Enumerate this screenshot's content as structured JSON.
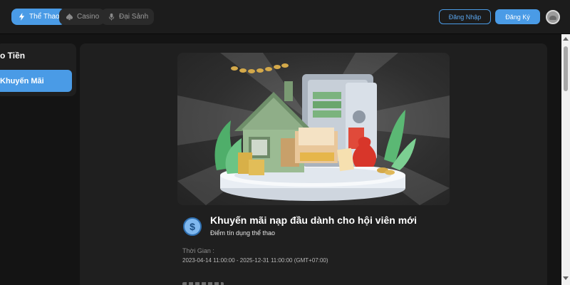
{
  "header": {
    "tabs": [
      {
        "label": "Thể Thao",
        "icon": "lightning-icon",
        "active": true
      },
      {
        "label": "Casino",
        "icon": "spade-icon",
        "active": false
      },
      {
        "label": "Đại Sảnh",
        "icon": "microphone-icon",
        "active": false
      }
    ],
    "login_label": "Đăng Nhập",
    "register_label": "Đăng Ký",
    "accent_color": "#4a9be6"
  },
  "sidebar": {
    "title": "o Tiền",
    "items": [
      {
        "label": "Khuyến Mãi",
        "active": true
      }
    ]
  },
  "promo": {
    "title": "Khuyến mãi nạp đầu dành cho hội viên mới",
    "subtitle": "Điểm tín dụng thể thao",
    "icon": "dollar-coin-icon",
    "time_label": "Thời Gian :",
    "time_value": "2023-04-14 11:00:00 - 2025-12-31 11:00:00 (GMT+07:00)"
  }
}
